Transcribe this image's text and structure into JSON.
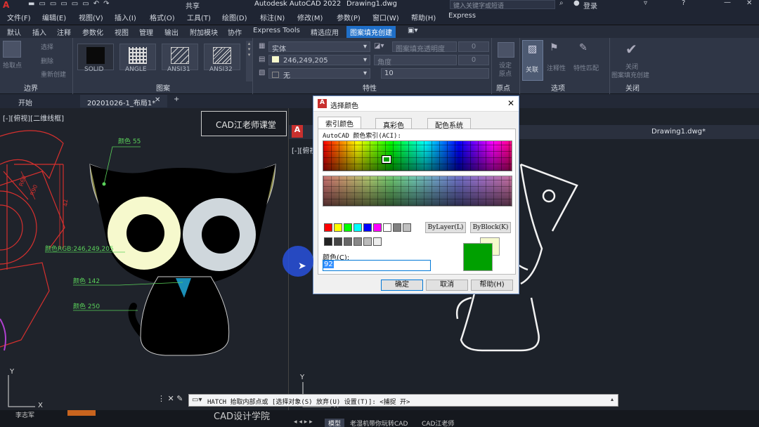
{
  "window": {
    "title": "Autodesk AutoCAD 2022",
    "file": "Drawing1.dwg",
    "share": "共享",
    "search_placeholder": "键入关键字或短语",
    "login": "登录"
  },
  "menu": [
    "文件(F)",
    "编辑(E)",
    "视图(V)",
    "插入(I)",
    "格式(O)",
    "工具(T)",
    "绘图(D)",
    "标注(N)",
    "修改(M)",
    "参数(P)",
    "窗口(W)",
    "帮助(H)",
    "Express"
  ],
  "ribbon_tabs": [
    "默认",
    "插入",
    "注释",
    "参数化",
    "视图",
    "管理",
    "输出",
    "附加模块",
    "协作",
    "Express Tools",
    "精选应用",
    "图案填充创建"
  ],
  "ribbon": {
    "boundary": {
      "pick_points": "拾取点",
      "select": "选择",
      "delete": "删除",
      "recreate": "重新创建",
      "label": "边界"
    },
    "pattern": {
      "tiles": [
        "SOLID",
        "ANGLE",
        "ANSI31",
        "ANSI32"
      ],
      "label": "图案"
    },
    "properties": {
      "type": "实体",
      "transparency_label": "图案填充透明度",
      "transparency_value": "0",
      "color": "246,249,205",
      "angle_label": "角度",
      "angle_value": "0",
      "bg": "无",
      "scale": "10",
      "label": "特性"
    },
    "origin": {
      "set": "设定",
      "origin": "原点",
      "label": "原点"
    },
    "options": {
      "assoc": "关联",
      "annotative": "注释性",
      "match": "特性匹配",
      "label": "选项"
    },
    "close": {
      "line1": "关闭",
      "line2": "图案填充创建",
      "label": "关闭"
    }
  },
  "doc_tabs": {
    "start": "开始",
    "file": "20201026-1_布局1*",
    "drawing": "Drawing1.dwg*"
  },
  "left_canvas": {
    "view_label": "[-][俯视][二维线框]",
    "watermark": "CAD江老师课堂",
    "annotations": [
      "颜色 55",
      "颜色RGB:246,249,205",
      "颜色 142",
      "颜色 250"
    ],
    "dims": [
      "R60",
      "R90",
      "42"
    ]
  },
  "right_canvas": {
    "view_label": "[-][俯视"
  },
  "command": {
    "text": "HATCH 拾取内部点或 [选择对象(S) 放弃(U) 设置(T)]:  <捕捉 开>"
  },
  "bottom": {
    "tabs": [
      "模型",
      "老湿机带你玩转CAD",
      "CAD江老师"
    ],
    "left_labels": [
      "李志军",
      "CAD设计学院"
    ]
  },
  "dialog": {
    "title": "选择颜色",
    "tabs": [
      "索引颜色",
      "真彩色",
      "配色系统"
    ],
    "aci_label": "AutoCAD 颜色索引(ACI):",
    "bylayer": "ByLayer(L)",
    "byblock": "ByBlock(K)",
    "color_label": "颜色(C):",
    "color_value": "92",
    "ok": "确定",
    "cancel": "取消",
    "help": "帮助(H)"
  },
  "colors": {
    "accent": "#1f6fc8",
    "selected_color": "#00a000",
    "cat_body": "#000000",
    "eye_left": "#f6f9cd",
    "eye_right": "#cfd7dc",
    "ear": "#8a8a4a",
    "beak": "#1b8fb8"
  }
}
